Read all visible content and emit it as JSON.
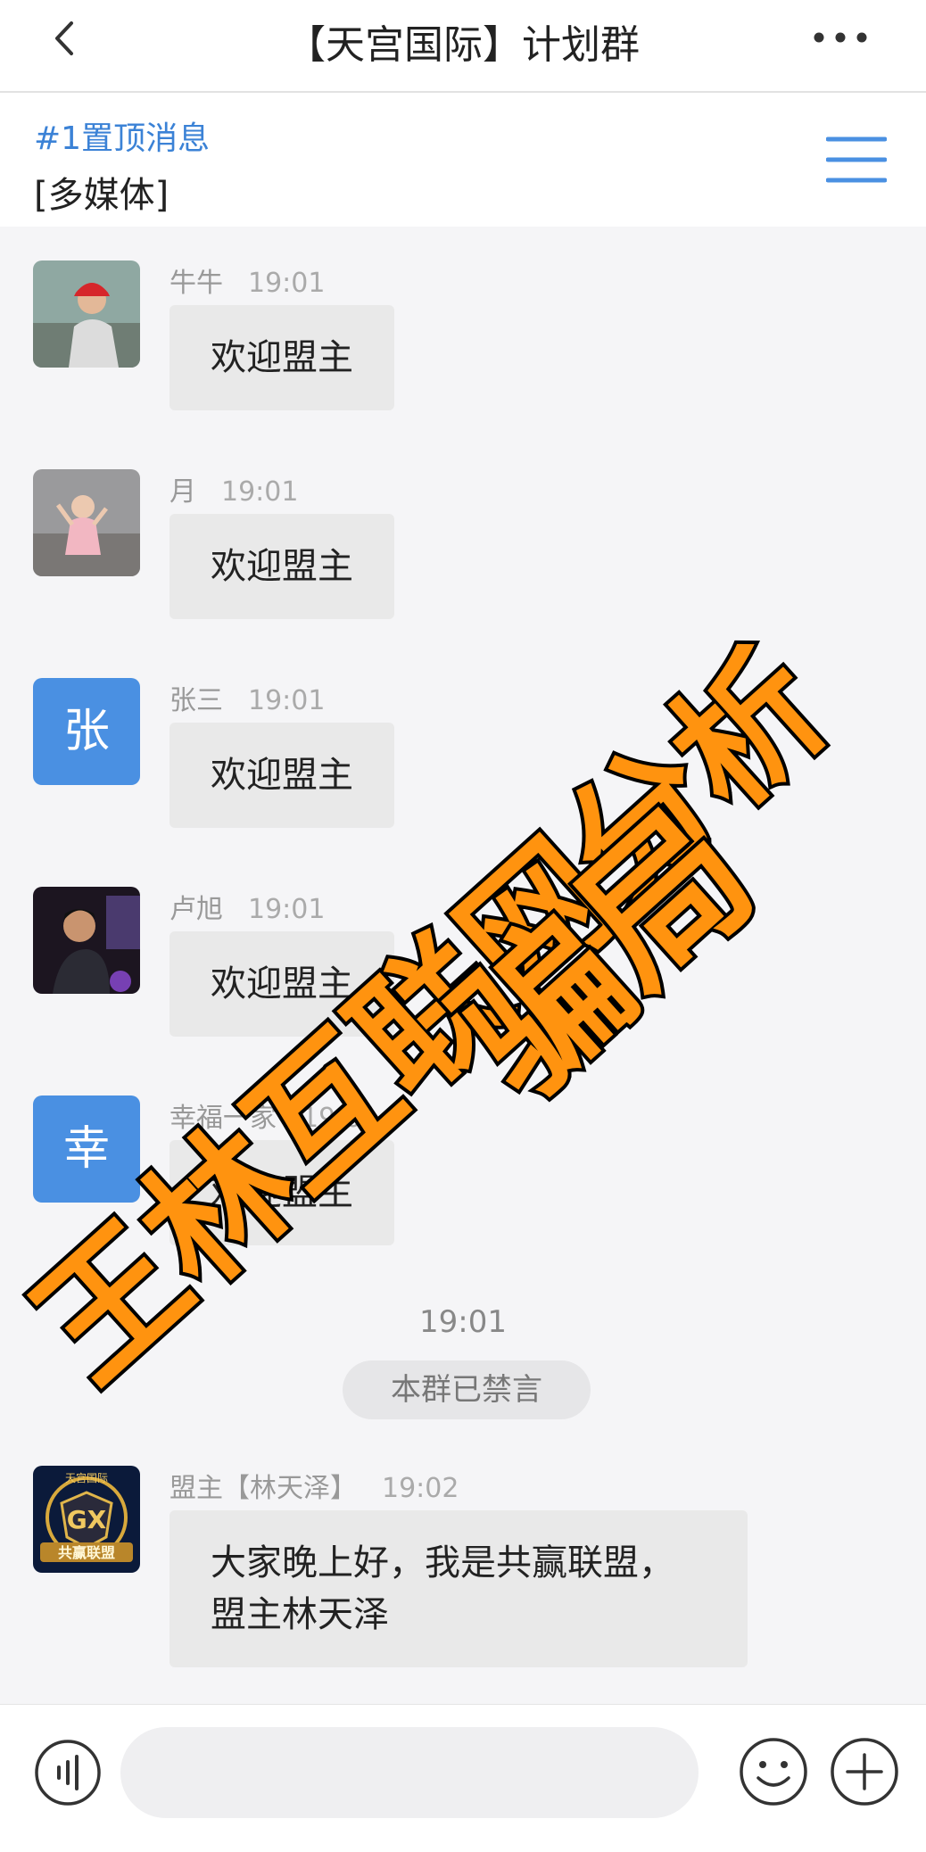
{
  "header": {
    "title": "【天宫国际】计划群"
  },
  "pinned": {
    "tag": "#1置顶消息",
    "content": "[多媒体]"
  },
  "messages": [
    {
      "sender": "牛牛",
      "time": "19:01",
      "text": "欢迎盟主"
    },
    {
      "sender": "月",
      "time": "19:01",
      "text": "欢迎盟主"
    },
    {
      "sender": "张三",
      "time": "19:01",
      "text": "欢迎盟主",
      "avatar_letter": "张"
    },
    {
      "sender": "卢旭",
      "time": "19:01",
      "text": "欢迎盟主"
    },
    {
      "sender": "幸福一家",
      "time": "19:01",
      "text": "欢迎盟主",
      "avatar_letter": "幸"
    },
    {
      "sender": "盟主【林天泽】",
      "time": "19:02",
      "text": "大家晚上好，我是共赢联盟，盟主林天泽"
    }
  ],
  "system": {
    "time": "19:01",
    "notice": "本群已禁言"
  },
  "leader_avatar": {
    "top_text": "天宫国际",
    "mid_text": "GX",
    "band_text": "共赢联盟"
  },
  "watermark": {
    "line1": "王林互联网分析",
    "line2": "骗局"
  },
  "colors": {
    "accent": "#3b82d6",
    "avatar_blue": "#4a90e2",
    "watermark": "#ff930f"
  }
}
